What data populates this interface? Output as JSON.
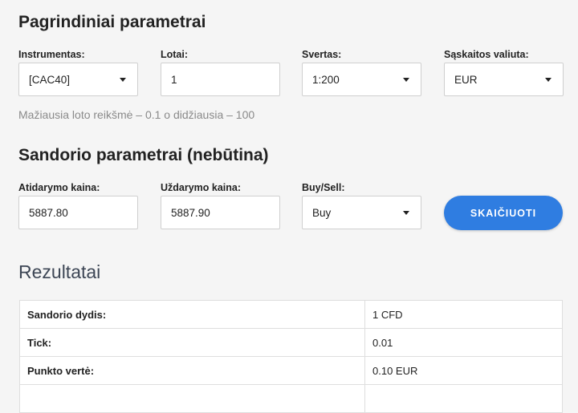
{
  "basic": {
    "title": "Pagrindiniai parametrai",
    "instrument": {
      "label": "Instrumentas:",
      "value": "[CAC40]"
    },
    "lots": {
      "label": "Lotai:",
      "value": "1"
    },
    "leverage": {
      "label": "Svertas:",
      "value": "1:200"
    },
    "currency": {
      "label": "Sąskaitos valiuta:",
      "value": "EUR"
    },
    "hint": "Mažiausia loto reikšmė – 0.1 o didžiausia – 100"
  },
  "trade": {
    "title": "Sandorio parametrai (nebūtina)",
    "open_price": {
      "label": "Atidarymo kaina:",
      "value": "5887.80"
    },
    "close_price": {
      "label": "Uždarymo kaina:",
      "value": "5887.90"
    },
    "direction": {
      "label": "Buy/Sell:",
      "value": "Buy"
    },
    "calculate_label": "SKAIČIUOTI"
  },
  "results": {
    "title": "Rezultatai",
    "rows": [
      {
        "key": "Sandorio dydis:",
        "value": "1 CFD"
      },
      {
        "key": "Tick:",
        "value": "0.01"
      },
      {
        "key": "Punkto vertė:",
        "value": "0.10 EUR"
      },
      {
        "key": "",
        "value": ""
      }
    ]
  }
}
